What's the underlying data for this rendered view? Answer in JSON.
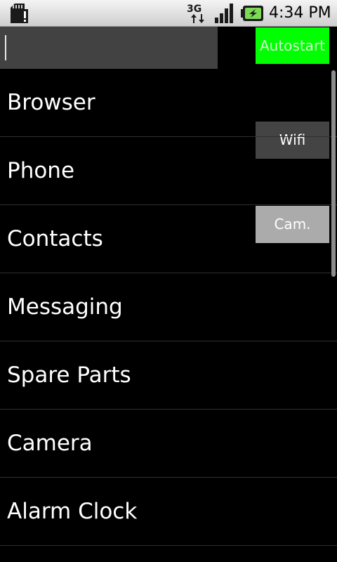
{
  "status_bar": {
    "time": "4:34 PM",
    "icons": [
      "sd-card-warning-icon",
      "3g-data-icon",
      "signal-strength-icon",
      "battery-charging-icon"
    ],
    "network_label": "3G"
  },
  "search": {
    "value": "",
    "placeholder": ""
  },
  "buttons": {
    "autostart": "Autostart",
    "wifi": "Wifi",
    "cam": "Cam."
  },
  "colors": {
    "autostart_bg": "#00ff00",
    "wifi_bg": "#444444",
    "cam_bg": "#ababab",
    "list_bg": "#000000"
  },
  "apps": [
    {
      "label": "Browser"
    },
    {
      "label": "Phone"
    },
    {
      "label": "Contacts"
    },
    {
      "label": "Messaging"
    },
    {
      "label": "Spare Parts"
    },
    {
      "label": "Camera"
    },
    {
      "label": "Alarm Clock"
    }
  ]
}
